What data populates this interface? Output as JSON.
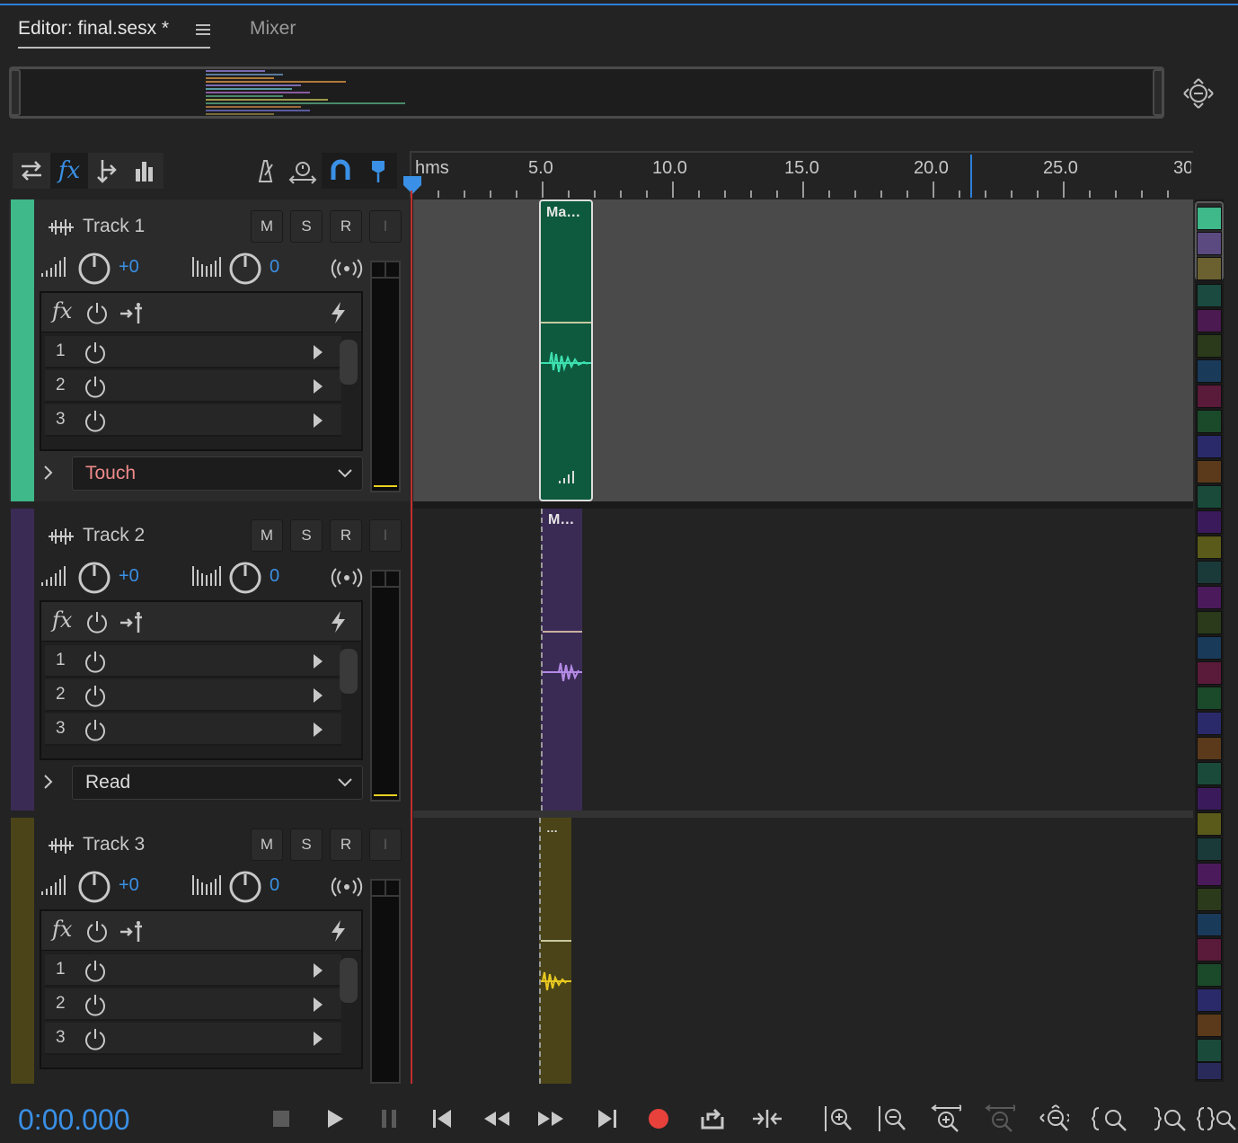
{
  "tabs": {
    "editor": "Editor: final.sesx *",
    "mixer": "Mixer"
  },
  "ruler": {
    "unit": "hms",
    "labels": [
      "5.0",
      "10.0",
      "15.0",
      "20.0",
      "25.0",
      "30"
    ]
  },
  "tracks": [
    {
      "name": "Track 1",
      "volume": "+0",
      "pan": "0",
      "automation": "Touch",
      "automation_color": "#f08a8a",
      "color": "#3fb88a",
      "clip_label": "Ma…",
      "fx_slots": [
        "1",
        "2",
        "3"
      ]
    },
    {
      "name": "Track 2",
      "volume": "+0",
      "pan": "0",
      "automation": "Read",
      "automation_color": "#dcdcdc",
      "color": "#3a2b55",
      "clip_label": "M…",
      "fx_slots": [
        "1",
        "2",
        "3"
      ]
    },
    {
      "name": "Track 3",
      "volume": "+0",
      "pan": "0",
      "automation": "",
      "automation_color": "#dcdcdc",
      "color": "#4a4418",
      "clip_label": "…",
      "fx_slots": [
        "1",
        "2",
        "3"
      ]
    }
  ],
  "track_buttons": {
    "mute": "M",
    "solo": "S",
    "record": "R",
    "input": "I"
  },
  "icons": {
    "fx": "fx",
    "reverse": "⇄"
  },
  "transport": {
    "time": "0:00.000"
  },
  "colors": {
    "accent": "#3a90e6",
    "record": "#e8413c",
    "playhead": "#c0302c"
  }
}
